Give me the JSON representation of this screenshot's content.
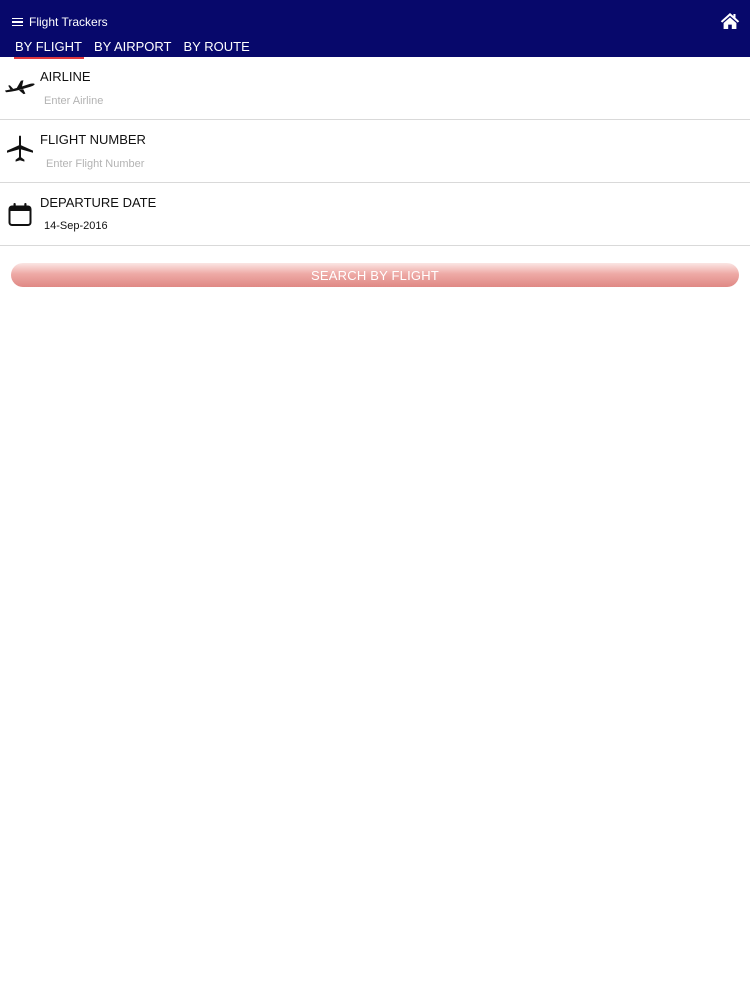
{
  "header": {
    "title": "Flight Trackers",
    "menu_icon": "hamburger-menu-icon",
    "home_icon": "home-icon",
    "background": "#07086b",
    "tabs": [
      {
        "label": "BY FLIGHT",
        "active": true
      },
      {
        "label": "BY AIRPORT",
        "active": false
      },
      {
        "label": "BY ROUTE",
        "active": false
      }
    ],
    "active_tab_indicator_color": "#e0393e"
  },
  "form": {
    "airline": {
      "label": "AIRLINE",
      "placeholder": "Enter Airline",
      "value": "",
      "icon": "airplane-takeoff-icon"
    },
    "flight_number": {
      "label": "FLIGHT NUMBER",
      "placeholder": "Enter Flight Number",
      "value": "",
      "icon": "airplane-icon"
    },
    "departure_date": {
      "label": "DEPARTURE DATE",
      "value": "14-Sep-2016",
      "icon": "calendar-icon"
    }
  },
  "search_button": {
    "label": "SEARCH BY FLIGHT",
    "color": "#e8a09c"
  }
}
